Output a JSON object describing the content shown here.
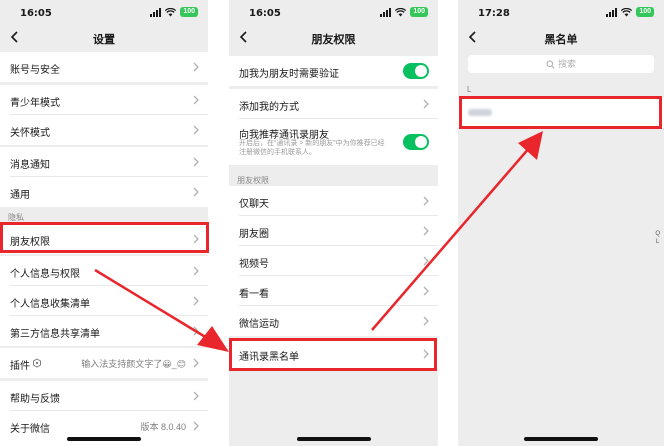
{
  "screen1": {
    "status": {
      "time": "16:05",
      "battery": "100"
    },
    "title": "设置",
    "rows": {
      "account": "账号与安全",
      "teen": "青少年模式",
      "care": "关怀模式",
      "notify": "消息通知",
      "general": "通用",
      "friend_perm": "朋友权限",
      "personal_info": "个人信息与权限",
      "info_list": "个人信息收集清单",
      "third_party": "第三方信息共享清单",
      "plugins": "插件",
      "plugins_value": "输入法支持颜文字了😀_😊",
      "help": "帮助与反馈",
      "about": "关于微信",
      "about_value": "版本 8.0.40"
    },
    "section_privacy": "隐私"
  },
  "screen2": {
    "status": {
      "time": "16:05",
      "battery": "100"
    },
    "title": "朋友权限",
    "rows": {
      "verify": "加我为朋友时需要验证",
      "add_methods": "添加我的方式",
      "recommend": "向我推荐通讯录朋友",
      "recommend_desc": "开启后，在“通讯录 > 新的朋友”中为你推荐已经注册微信的手机联系人。",
      "chat_only": "仅聊天",
      "moments": "朋友圈",
      "channels": "视频号",
      "look": "看一看",
      "sports": "微信运动",
      "blacklist": "通讯录黑名单"
    },
    "section_friend": "朋友权限"
  },
  "screen3": {
    "status": {
      "time": "17:28",
      "battery": "100"
    },
    "title": "黑名单",
    "search_placeholder": "搜索",
    "index_letter": "L",
    "side_index": [
      "Q",
      "L"
    ]
  },
  "colors": {
    "highlight": "#e8262b",
    "toggle_on": "#07c160",
    "page_bg": "#ededed"
  }
}
